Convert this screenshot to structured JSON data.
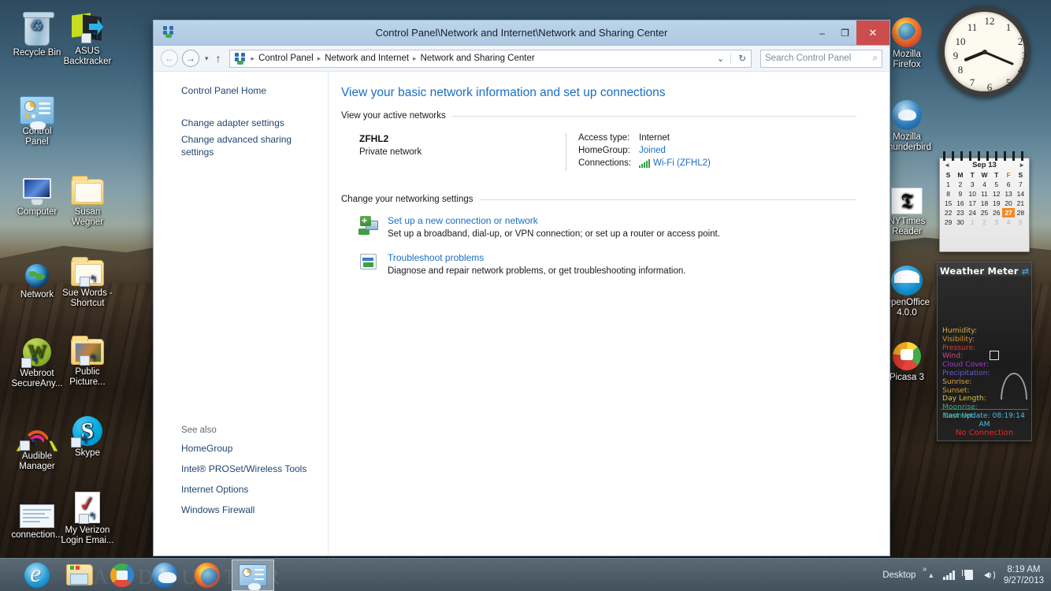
{
  "desktop": {
    "icons_left": [
      {
        "label": "Recycle Bin",
        "icon": "recycle-bin-icon"
      },
      {
        "label": "ASUS\nBacktracker",
        "icon": "asus-backtracker-icon"
      },
      {
        "label": "Control\nPanel",
        "icon": "control-panel-icon"
      },
      {
        "label": "Computer",
        "icon": "computer-icon"
      },
      {
        "label": "Susan\nWegner",
        "icon": "folder-icon"
      },
      {
        "label": "Network",
        "icon": "network-globe-icon"
      },
      {
        "label": "Sue Words -\nShortcut",
        "icon": "folder-shortcut-icon"
      },
      {
        "label": "Webroot\nSecureAny...",
        "icon": "webroot-icon"
      },
      {
        "label": "Public\nPicture...",
        "icon": "pictures-folder-icon"
      },
      {
        "label": "Audible\nManager",
        "icon": "audible-manager-icon"
      },
      {
        "label": "Skype",
        "icon": "skype-icon"
      },
      {
        "label": "connection...",
        "icon": "screenshot-icon"
      },
      {
        "label": "My Verizon\nLogin Emai...",
        "icon": "document-icon"
      }
    ],
    "icons_right": [
      {
        "label": "Mozilla\nFirefox",
        "icon": "firefox-icon"
      },
      {
        "label": "Mozilla\nThunderbird",
        "icon": "thunderbird-icon"
      },
      {
        "label": "NYTimes Reader",
        "icon": "nytimes-reader-icon"
      },
      {
        "label": "OpenOffice\n4.0.0",
        "icon": "openoffice-icon"
      },
      {
        "label": "Picasa 3",
        "icon": "picasa-icon"
      }
    ]
  },
  "clock_gadget": {
    "numbers": [
      "12",
      "1",
      "2",
      "3",
      "4",
      "5",
      "6",
      "7",
      "8",
      "9",
      "10",
      "11"
    ],
    "time_shown": "8:19"
  },
  "calendar_gadget": {
    "month_label": "Sep 13",
    "prev_arrow": "◄",
    "next_arrow": "►",
    "day_headers": [
      "S",
      "M",
      "T",
      "W",
      "T",
      "F",
      "S"
    ],
    "weeks": [
      [
        {
          "d": "1"
        },
        {
          "d": "2"
        },
        {
          "d": "3"
        },
        {
          "d": "4"
        },
        {
          "d": "5"
        },
        {
          "d": "6"
        },
        {
          "d": "7"
        }
      ],
      [
        {
          "d": "8"
        },
        {
          "d": "9"
        },
        {
          "d": "10"
        },
        {
          "d": "11"
        },
        {
          "d": "12"
        },
        {
          "d": "13"
        },
        {
          "d": "14"
        }
      ],
      [
        {
          "d": "15"
        },
        {
          "d": "16"
        },
        {
          "d": "17"
        },
        {
          "d": "18"
        },
        {
          "d": "19"
        },
        {
          "d": "20"
        },
        {
          "d": "21"
        }
      ],
      [
        {
          "d": "22"
        },
        {
          "d": "23"
        },
        {
          "d": "24"
        },
        {
          "d": "25"
        },
        {
          "d": "26"
        },
        {
          "d": "27",
          "today": true
        },
        {
          "d": "28"
        }
      ],
      [
        {
          "d": "29"
        },
        {
          "d": "30"
        },
        {
          "d": "1",
          "dim": true
        },
        {
          "d": "2",
          "dim": true
        },
        {
          "d": "3",
          "dim": true
        },
        {
          "d": "4",
          "dim": true
        },
        {
          "d": "5",
          "dim": true
        }
      ]
    ],
    "today_color": "#f28a1e"
  },
  "weather_gadget": {
    "title": "Weather Meter",
    "refresh_icon": "refresh-icon",
    "fields": [
      {
        "label": "Humidity:",
        "color": "#d8b23c"
      },
      {
        "label": "Visibility:",
        "color": "#d8943c"
      },
      {
        "label": "Pressure:",
        "color": "#d83c3c"
      },
      {
        "label": "Wind:",
        "color": "#c44a8a"
      },
      {
        "label": "Cloud Cover:",
        "color": "#a13cd8"
      },
      {
        "label": "Precipitation:",
        "color": "#6a5ad8"
      },
      {
        "label": "Sunrise:",
        "color": "#d8a43c"
      },
      {
        "label": "Sunset:",
        "color": "#d8a43c"
      },
      {
        "label": "Day Length:",
        "color": "#d8c23c"
      },
      {
        "label": "Moonrise:",
        "color": "#3cb07a"
      },
      {
        "label": "Moonset:",
        "color": "#3cb07a"
      }
    ],
    "last_update": "Last Update: 08:19:14 AM",
    "status": "No Connection"
  },
  "window": {
    "title": "Control Panel\\Network and Internet\\Network and Sharing Center",
    "title_icon": "network-sharing-icon",
    "buttons": {
      "minimize": "–",
      "maximize": "❐",
      "close": "✕"
    },
    "addressbar": {
      "back": "←",
      "forward": "→",
      "recent": "▾",
      "up": "↑",
      "path_icon": "network-sharing-icon",
      "crumbs": [
        "Control Panel",
        "Network and Internet",
        "Network and Sharing Center"
      ],
      "separator": "▸",
      "dropdown": "⌄",
      "refresh": "↻",
      "search_placeholder": "Search Control Panel",
      "search_icon": "search-icon"
    }
  },
  "nav": {
    "home_link": "Control Panel Home",
    "links": [
      "Change adapter settings",
      "Change advanced sharing settings"
    ],
    "see_also_title": "See also",
    "see_also": [
      "HomeGroup",
      "Intel® PROSet/Wireless Tools",
      "Internet Options",
      "Windows Firewall"
    ]
  },
  "content": {
    "page_title": "View your basic network information and set up connections",
    "active_networks_heading": "View your active networks",
    "network": {
      "name": "ZFHL2",
      "type": "Private network",
      "access_type_label": "Access type:",
      "access_type_value": "Internet",
      "homegroup_label": "HomeGroup:",
      "homegroup_value": "Joined",
      "connections_label": "Connections:",
      "connections_value": "Wi-Fi (ZFHL2)",
      "connections_icon": "wifi-signal-icon"
    },
    "settings_heading": "Change your networking settings",
    "tasks": [
      {
        "link": "Set up a new connection or network",
        "desc": "Set up a broadband, dial-up, or VPN connection; or set up a router or access point.",
        "icon": "new-connection-icon"
      },
      {
        "link": "Troubleshoot problems",
        "desc": "Diagnose and repair network problems, or get troubleshooting information.",
        "icon": "troubleshoot-icon"
      }
    ]
  },
  "taskbar": {
    "watermark": "ANDRUSTOR",
    "items": [
      {
        "name": "internet-explorer",
        "icon": "internet-explorer-icon"
      },
      {
        "name": "file-explorer",
        "icon": "file-explorer-icon"
      },
      {
        "name": "openoffice",
        "icon": "openoffice-icon"
      },
      {
        "name": "thunderbird",
        "icon": "thunderbird-icon"
      },
      {
        "name": "firefox",
        "icon": "firefox-icon"
      },
      {
        "name": "control-panel",
        "icon": "control-panel-icon",
        "active": true
      }
    ],
    "tray": {
      "desktop_label": "Desktop",
      "chevron": "»",
      "show_hidden": "▲",
      "network_icon": "signal-bars-icon",
      "battery_icon": "battery-charging-icon",
      "volume_icon": "volume-icon",
      "time": "8:19 AM",
      "date": "9/27/2013"
    }
  },
  "colors": {
    "accent_link": "#1b6ec2",
    "title_blue": "#1b6ec2",
    "close_red": "#cb4d4d",
    "titlebar": "#bdd4e8"
  }
}
